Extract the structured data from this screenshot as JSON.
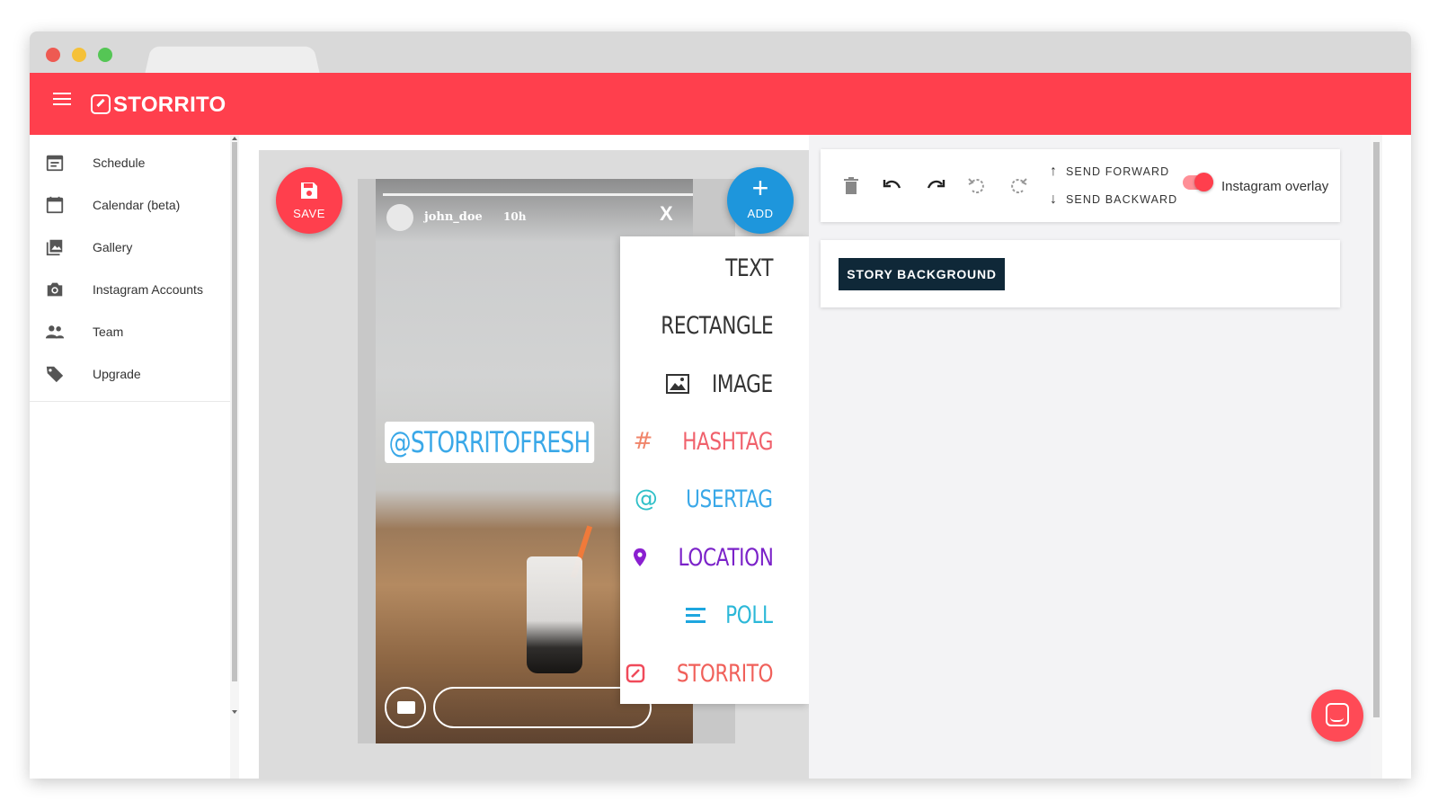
{
  "app": {
    "brand": "STORRITO",
    "accent_color": "#ff3f4d",
    "menu_icon": "hamburger-icon",
    "logo_icon": "storrito-logo-icon"
  },
  "sidebar": {
    "items": [
      {
        "label": "Schedule",
        "icon": "calendar-list-icon"
      },
      {
        "label": "Calendar (beta)",
        "icon": "calendar-icon"
      },
      {
        "label": "Gallery",
        "icon": "gallery-icon"
      },
      {
        "label": "Instagram Accounts",
        "icon": "camera-icon"
      },
      {
        "label": "Team",
        "icon": "team-icon"
      },
      {
        "label": "Upgrade",
        "icon": "tag-icon"
      }
    ]
  },
  "editor": {
    "save_label": "SAVE",
    "save_icon": "floppy-disk-icon",
    "add_label": "ADD",
    "add_icon": "plus-icon",
    "story": {
      "username": "john_doe",
      "time": "10h",
      "close_label": "X",
      "usertag_text": "@STORRITOFRESH"
    },
    "add_menu": [
      {
        "label": "TEXT",
        "icon": "",
        "color": "#333333"
      },
      {
        "label": "RECTANGLE",
        "icon": "",
        "color": "#333333"
      },
      {
        "label": "IMAGE",
        "icon": "image-icon",
        "color": "#333333"
      },
      {
        "label": "HASHTAG",
        "icon": "hash-icon",
        "color": "#f0616c"
      },
      {
        "label": "USERTAG",
        "icon": "at-icon",
        "color": "#3aa8e8"
      },
      {
        "label": "LOCATION",
        "icon": "location-pin-icon",
        "color": "#7b22c9"
      },
      {
        "label": "POLL",
        "icon": "poll-lines-icon",
        "color": "#1ea6df"
      },
      {
        "label": "STORRITO",
        "icon": "storrito-logo-icon",
        "color": "#f04a5a"
      }
    ]
  },
  "toolbar": {
    "delete_icon": "trash-icon",
    "undo_icon": "undo-icon",
    "redo_icon": "redo-icon",
    "rotate_left_icon": "rotate-left-icon",
    "rotate_right_icon": "rotate-right-icon",
    "send_forward": "SEND FORWARD",
    "send_backward": "SEND BACKWARD",
    "overlay_label": "Instagram overlay",
    "overlay_enabled": true
  },
  "background_panel": {
    "button_label": "STORY BACKGROUND"
  },
  "chat": {
    "icon": "chat-icon"
  }
}
